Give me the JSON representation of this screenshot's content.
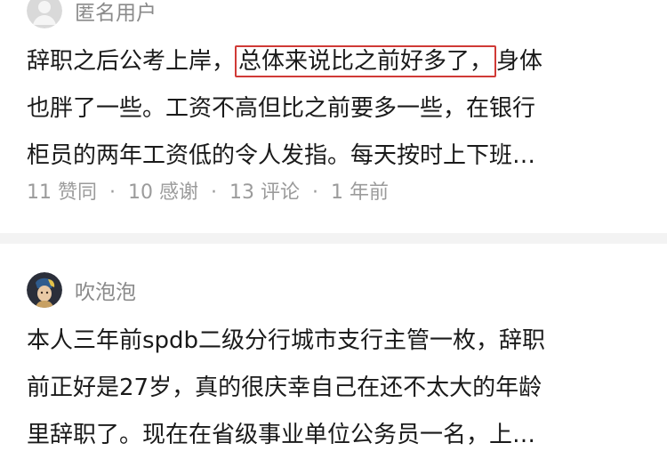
{
  "answers": [
    {
      "author": {
        "name": "匿名用户",
        "avatar_icon": "anonymous-avatar-icon"
      },
      "lines": [
        {
          "before": "辞职之后公考上岸，",
          "highlight": "总体来说比之前好多了，",
          "after": "身体"
        },
        {
          "text": "也胖了一些。工资不高但比之前要多一些，在银行"
        },
        {
          "text": "柜员的两年工资低的令人发指。每天按时上下班…"
        }
      ],
      "meta": {
        "likes": "11 赞同",
        "thanks": "10 感谢",
        "comments": "13 评论",
        "time": "1 年前",
        "separator": "·"
      }
    },
    {
      "author": {
        "name": "吹泡泡",
        "avatar_icon": "girl-portrait-avatar-icon"
      },
      "lines": [
        {
          "text": "本人三年前spdb二级分行城市支行主管一枚，辞职"
        },
        {
          "text": "前正好是27岁，真的很庆幸自己在还不太大的年龄"
        },
        {
          "text": "里辞职了。现在在省级事业单位公务员一名，上…"
        }
      ]
    }
  ],
  "colors": {
    "highlight_border": "#d03a36",
    "meta_text": "#9b9b9b",
    "separator": "#f3f3f3"
  }
}
